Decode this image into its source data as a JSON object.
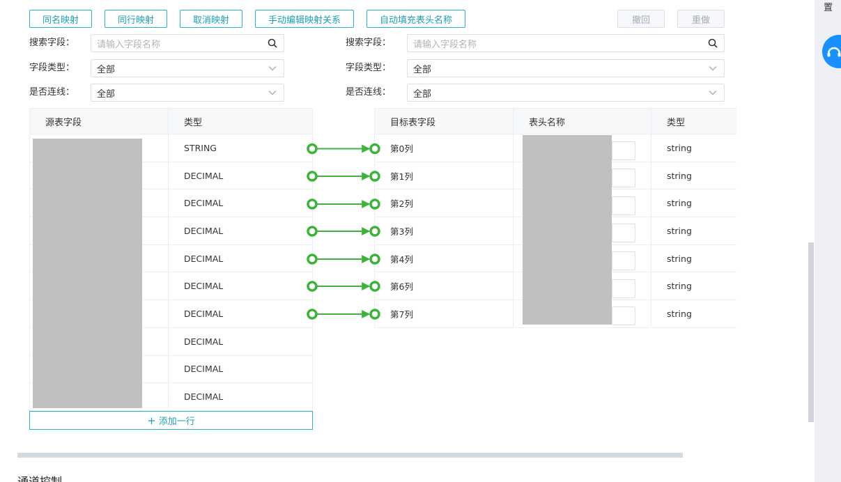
{
  "toolbar": {
    "same_name": "同名映射",
    "same_row": "同行映射",
    "cancel": "取消映射",
    "manual": "手动编辑映射关系",
    "autofill": "自动填充表头名称",
    "undo": "撤回",
    "redo": "重做"
  },
  "left_filters": {
    "search_label": "搜索字段：",
    "search_placeholder": "请输入字段名称",
    "type_label": "字段类型：",
    "type_value": "全部",
    "linked_label": "是否连线：",
    "linked_value": "全部"
  },
  "right_filters": {
    "search_label": "搜索字段：",
    "search_placeholder": "请输入字段名称",
    "type_label": "字段类型：",
    "type_value": "全部",
    "linked_label": "是否连线：",
    "linked_value": "全部"
  },
  "source_table": {
    "headers": [
      "源表字段",
      "类型"
    ],
    "types": [
      "STRING",
      "DECIMAL",
      "DECIMAL",
      "DECIMAL",
      "DECIMAL",
      "DECIMAL",
      "DECIMAL",
      "DECIMAL",
      "DECIMAL",
      "DECIMAL"
    ]
  },
  "target_table": {
    "headers": [
      "目标表字段",
      "表头名称",
      "类型"
    ],
    "fields": [
      "第0列",
      "第1列",
      "第2列",
      "第3列",
      "第4列",
      "第6列",
      "第7列"
    ],
    "types": [
      "string",
      "string",
      "string",
      "string",
      "string",
      "string",
      "string"
    ]
  },
  "add_row": {
    "plus": "+",
    "label": "添加一行"
  },
  "section": {
    "title": "通道控制"
  },
  "side_panel": {
    "label": "置"
  },
  "colors": {
    "accent": "#2ab3c7",
    "link_green": "#3cb43c",
    "fab_blue": "#1890ff"
  }
}
